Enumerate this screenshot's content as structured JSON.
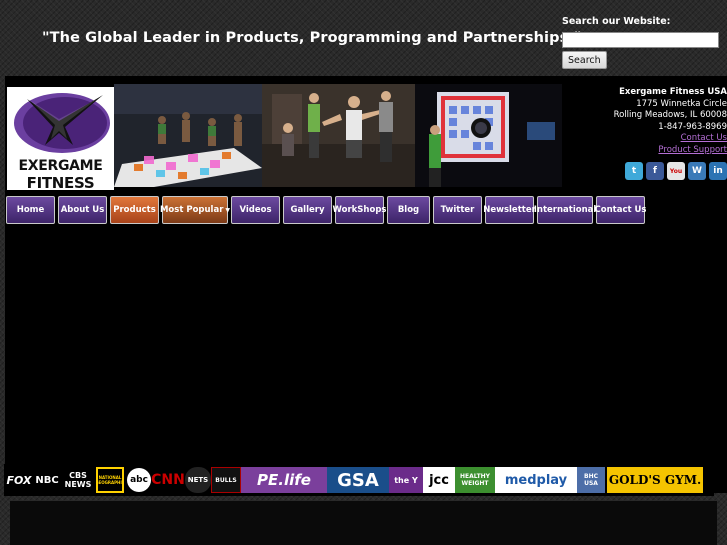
{
  "header": {
    "tagline": "\"The Global Leader in Products, Programming and Partnerships.\""
  },
  "search": {
    "label": "Search our Website:",
    "placeholder": "",
    "button_label": "Search"
  },
  "logo": {
    "line1": "EXERGAME",
    "line2": "FITNESS"
  },
  "company": {
    "name": "Exergame Fitness USA",
    "address1": "1775 Winnetka Circle",
    "address2": "Rolling Meadows, IL 60008",
    "phone": "1-847-963-8969",
    "contact_link": "Contact Us",
    "support_link": "Product Support"
  },
  "social": [
    {
      "icon": "twitter-icon",
      "color": "#3fa9d9"
    },
    {
      "icon": "facebook-icon",
      "color": "#3b5998"
    },
    {
      "icon": "youtube-icon",
      "color": "#d9d9d9"
    },
    {
      "icon": "wordpress-icon",
      "color": "#3a7ab8"
    },
    {
      "icon": "linkedin-icon",
      "color": "#2b73b3"
    }
  ],
  "nav": [
    {
      "label": "Home"
    },
    {
      "label": "About Us"
    },
    {
      "label": "Products",
      "active": true
    },
    {
      "label": "Most Popular",
      "dropdown": true
    },
    {
      "label": "Videos"
    },
    {
      "label": "Gallery"
    },
    {
      "label": "WorkShops"
    },
    {
      "label": "Blog"
    },
    {
      "label": "Twitter"
    },
    {
      "label": "Newsletter"
    },
    {
      "label": "International"
    },
    {
      "label": "Contact Us"
    }
  ],
  "media_logos": [
    {
      "text": "FOX",
      "color": "#ffffff",
      "bg": "#000000"
    },
    {
      "text": "NBC",
      "color": "#ffffff",
      "bg": "#000000"
    },
    {
      "text": "CBS NEWS",
      "color": "#ffffff",
      "bg": "#000000"
    },
    {
      "text": "NATIONAL GEOGRAPHIC",
      "color": "#ffd200",
      "bg": "#000000"
    },
    {
      "text": "abc",
      "color": "#000000",
      "bg": "#ffffff"
    },
    {
      "text": "CNN",
      "color": "#cc0000",
      "bg": "#000000"
    },
    {
      "text": "NETS",
      "color": "#ffffff",
      "bg": "#222222"
    },
    {
      "text": "BULLS",
      "color": "#ffffff",
      "bg": "#111111"
    },
    {
      "text": "PE.life",
      "color": "#ffffff",
      "bg": "#7b3f9c"
    },
    {
      "text": "GSA",
      "color": "#ffffff",
      "bg": "#1a4e8a"
    },
    {
      "text": "the Y",
      "color": "#ffffff",
      "bg": "#6b2b8a"
    },
    {
      "text": "jcc",
      "color": "#000000",
      "bg": "#ffffff"
    },
    {
      "text": "HEALTHY WEIGHT",
      "color": "#ffffff",
      "bg": "#3c8f2f"
    },
    {
      "text": "medplay",
      "color": "#1f5aa8",
      "bg": "#ffffff"
    },
    {
      "text": "BHC USA",
      "color": "#ffffff",
      "bg": "#4d6ea8"
    },
    {
      "text": "GOLD'S GYM.",
      "color": "#000000",
      "bg": "#f5c400"
    }
  ]
}
